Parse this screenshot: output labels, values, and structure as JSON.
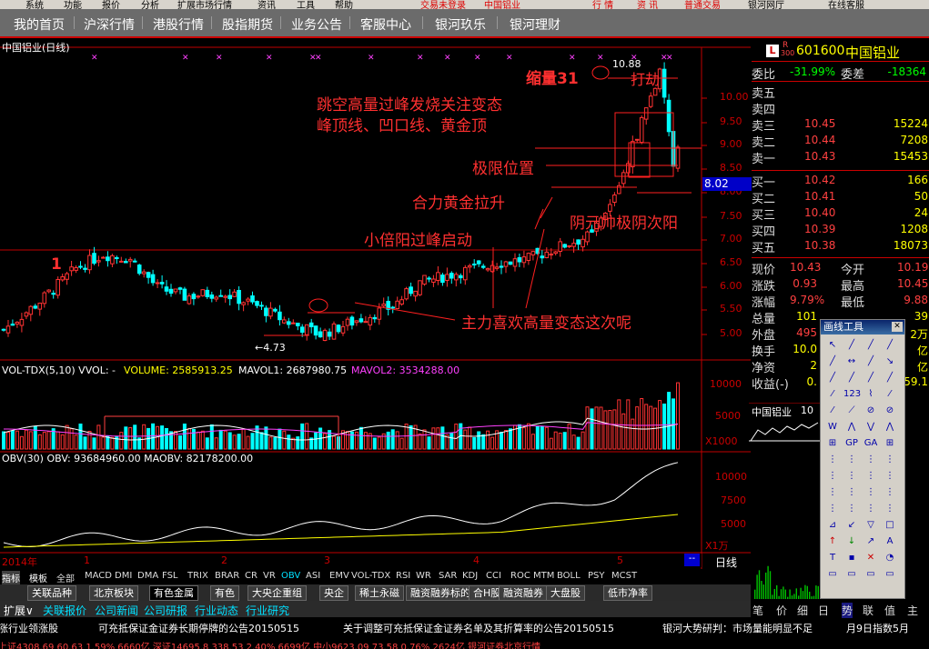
{
  "top_bar": {
    "left": [
      "系统",
      "功能",
      "报价",
      "分析",
      "扩展市场行情",
      "资讯",
      "工具",
      "帮助"
    ],
    "center": [
      "交易未登录",
      "中国铝业"
    ],
    "right": [
      "行 情",
      "资 讯",
      "普通交易",
      "银河网厅",
      "在线客服"
    ]
  },
  "nav": [
    "我的首页",
    "沪深行情",
    "港股行情",
    "股指期货",
    "业务公告",
    "客服中心",
    "银河玖乐",
    "银河理财"
  ],
  "chart": {
    "title": "中国铝业(日线)",
    "annotations": {
      "shrink": "缩量31",
      "high": "10.88",
      "rob": "打劫",
      "line1": "跳空高量过峰发烧关注变态",
      "line2": "峰顶线、凹口线、黄金顶",
      "limit": "极限位置",
      "force": "合力黄金拉升",
      "yin": "阴元帅极阴次阳",
      "small": "小倍阳过峰启动",
      "main": "主力喜欢高量变态这次呢",
      "low": "←4.73",
      "one": "1"
    },
    "price_axis": [
      "10.00",
      "9.50",
      "9.00",
      "8.50",
      "8.00",
      "7.50",
      "7.00",
      "6.50",
      "6.00",
      "5.50",
      "5.00"
    ],
    "current_price_tag": "8.02",
    "volume_label": "VOL-TDX(5,10)  VVOL: -",
    "volume_values": {
      "volume": "VOLUME: 2585913.25",
      "mavol1": "MAVOL1: 2687980.75",
      "mavol2": "MAVOL2: 3534288.00"
    },
    "volume_axis": [
      "10000",
      "5000"
    ],
    "volume_unit": "X1000",
    "obv_label": "OBV(30)  OBV: 93684960.00  MAOBV: 82178200.00",
    "obv_axis": [
      "10000",
      "7500",
      "5000"
    ],
    "obv_unit": "X1万",
    "date_axis": [
      "2014年",
      "1",
      "2",
      "3",
      "4",
      "5"
    ],
    "date_mode": "日线"
  },
  "indicator_tabs": [
    "指标",
    "模板",
    "全部",
    "MACD",
    "DMI",
    "DMA",
    "FSL",
    "TRIX",
    "BRAR",
    "CR",
    "VR",
    "OBV",
    "ASI",
    "EMV",
    "VOL-TDX",
    "RSI",
    "WR",
    "SAR",
    "KDJ",
    "CCI",
    "ROC",
    "MTM",
    "BOLL",
    "PSY",
    "MCST"
  ],
  "sector_tabs": [
    "关联品种",
    "北京板块",
    "有色金属",
    "有色",
    "大央企重组",
    "央企",
    "稀土永磁",
    "融资融券标的",
    "合H股",
    "融资融券",
    "大盘股",
    "低市净率"
  ],
  "bottom_bar": {
    "row1": [
      "扩展∨",
      "关联报价",
      "公司新闻",
      "公司研报",
      "行业动态",
      "行业研究"
    ],
    "ticker": [
      "涨行业领涨股",
      "可充抵保证金证券长期停牌的公告20150515",
      "关于调整可充抵保证金证券名单及其折算率的公告20150515",
      "银河大势研判：市场量能明显不足",
      "月9日指数5月"
    ],
    "row3": "上证4308.69  60.63  1.59%  6660亿  深证14695.8  338.53  2.40%  6699亿  中小9623.09  73.58  0.76%  2624亿  银河证券北京行情"
  },
  "quote": {
    "code": "601600",
    "name": "中国铝业",
    "badge": "L",
    "badge_r": "R",
    "badge_300": "300",
    "webi": "委比",
    "webi_val": "-31.99%",
    "wecha": "委差",
    "wecha_val": "-18364",
    "sell": [
      {
        "label": "卖五",
        "price": "",
        "vol": ""
      },
      {
        "label": "卖四",
        "price": "",
        "vol": ""
      },
      {
        "label": "卖三",
        "price": "10.45",
        "vol": "15224"
      },
      {
        "label": "卖二",
        "price": "10.44",
        "vol": "7208"
      },
      {
        "label": "卖一",
        "price": "10.43",
        "vol": "15453"
      }
    ],
    "buy": [
      {
        "label": "买一",
        "price": "10.42",
        "vol": "166"
      },
      {
        "label": "买二",
        "price": "10.41",
        "vol": "50"
      },
      {
        "label": "买三",
        "price": "10.40",
        "vol": "24"
      },
      {
        "label": "买四",
        "price": "10.39",
        "vol": "1208"
      },
      {
        "label": "买五",
        "price": "10.38",
        "vol": "18073"
      }
    ],
    "stats": [
      {
        "l": "现价",
        "v": "10.43",
        "l2": "今开",
        "v2": "10.19"
      },
      {
        "l": "涨跌",
        "v": "0.93",
        "l2": "最高",
        "v2": "10.45"
      },
      {
        "l": "涨幅",
        "v": "9.79%",
        "l2": "最低",
        "v2": "9.88"
      },
      {
        "l": "总量",
        "v": "101",
        "l2": "",
        "v2": "39"
      },
      {
        "l": "外盘",
        "v": "495",
        "l2": "",
        "v2": "2万"
      },
      {
        "l": "换手",
        "v": "10.0",
        "l2": "",
        "v2": "亿"
      },
      {
        "l": "净资",
        "v": "2",
        "l2": "",
        "v2": "亿"
      },
      {
        "l": "收益(-)",
        "v": "0.",
        "l2": "",
        "v2": "59.1"
      }
    ],
    "mini_title": "中国铝业",
    "mini_val": "10",
    "right_tabs": [
      "笔",
      "价",
      "细",
      "日",
      "势",
      "联",
      "值",
      "主"
    ]
  },
  "toolbox": {
    "title": "画线工具",
    "close": "✕"
  },
  "colors": {
    "up": "#ff3232",
    "down": "#00ffff",
    "annot": "#ff3030",
    "ma": "#ffff00",
    "axis": "#c00000"
  }
}
